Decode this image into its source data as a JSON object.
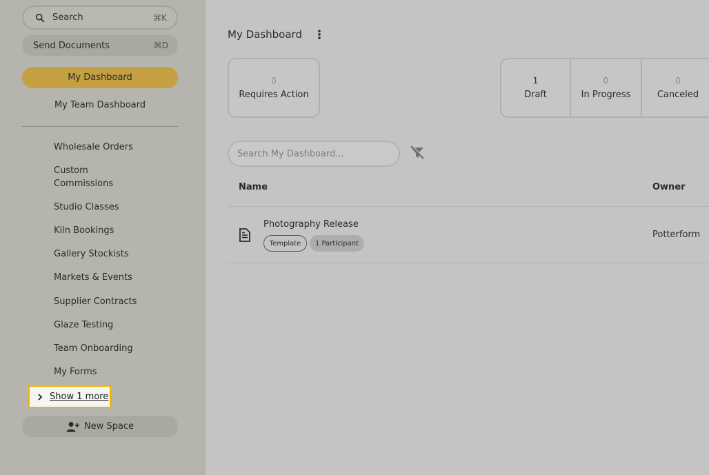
{
  "sidebar": {
    "search": {
      "label": "Search",
      "shortcut": "⌘K"
    },
    "send_documents": {
      "label": "Send Documents",
      "shortcut": "⌘D"
    },
    "nav": {
      "my_dashboard": "My Dashboard",
      "my_team_dashboard": "My Team Dashboard"
    },
    "spaces": [
      "Wholesale Orders",
      "Custom Commissions",
      "Studio Classes",
      "Kiln Bookings",
      "Gallery Stockists",
      "Markets & Events",
      "Supplier Contracts",
      "Glaze Testing",
      "Team Onboarding",
      "My Forms"
    ],
    "show_more": "Show 1 more",
    "new_space": "New Space"
  },
  "main": {
    "title": "My Dashboard",
    "requires_action": {
      "count": "0",
      "label": "Requires Action"
    },
    "statuses": [
      {
        "count": "1",
        "label": "Draft"
      },
      {
        "count": "0",
        "label": "In Progress"
      },
      {
        "count": "0",
        "label": "Canceled"
      }
    ],
    "search_placeholder": "Search My Dashboard...",
    "table": {
      "headers": {
        "name": "Name",
        "owner": "Owner"
      },
      "rows": [
        {
          "title": "Photography Release",
          "tags": [
            "Template",
            "1 Participant"
          ],
          "owner": "Potterform"
        }
      ]
    }
  },
  "colors": {
    "accent": "#c5a042",
    "focus_ring": "#f1b400"
  }
}
